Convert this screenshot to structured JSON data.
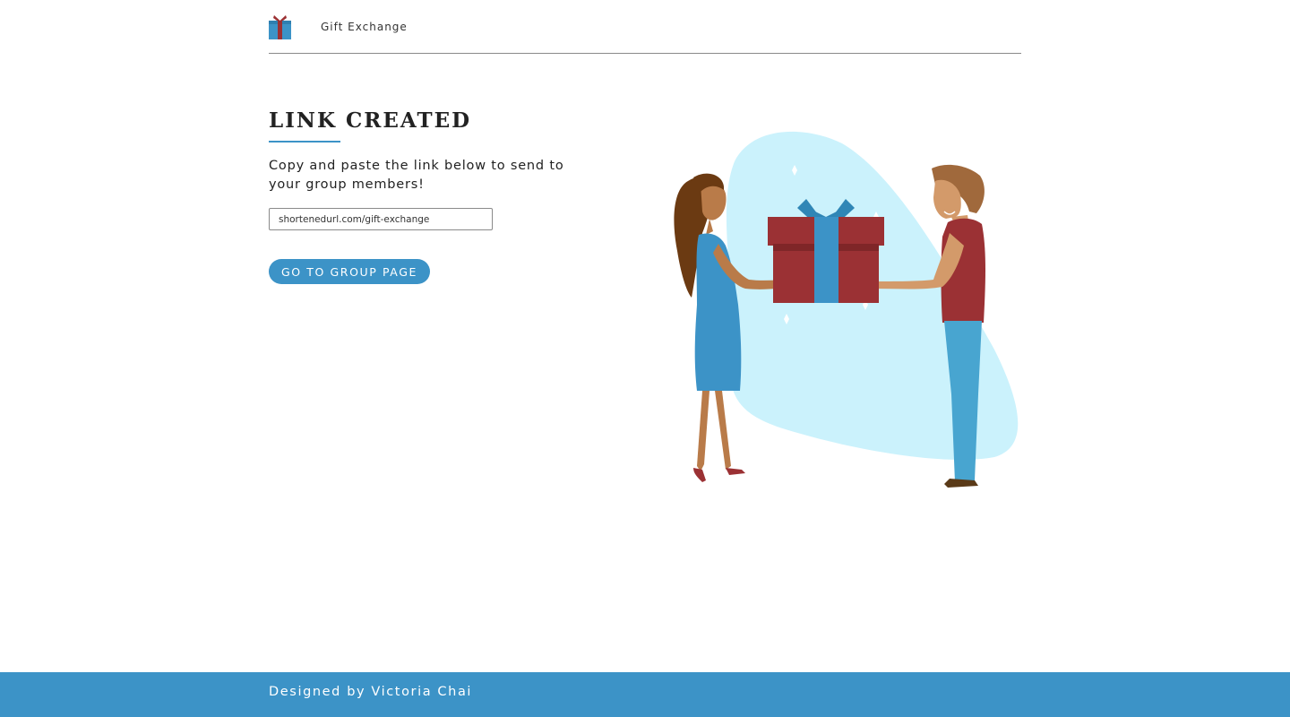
{
  "header": {
    "logo_icon": "gift-box-icon",
    "brand": "Gift Exchange"
  },
  "main": {
    "title": "LINK CREATED",
    "instructions": "Copy and paste the link below to send to your group members!",
    "link_value": "shortenedurl.com/gift-exchange",
    "button_label": "GO TO GROUP PAGE"
  },
  "illustration": {
    "name": "two-people-exchanging-gift-illustration"
  },
  "footer": {
    "credit": "Designed by Victoria Chai"
  },
  "colors": {
    "accent": "#3c93c7",
    "gift_red": "#9b3134",
    "gift_blue": "#3c93c7",
    "blob": "#cbf2fc"
  }
}
